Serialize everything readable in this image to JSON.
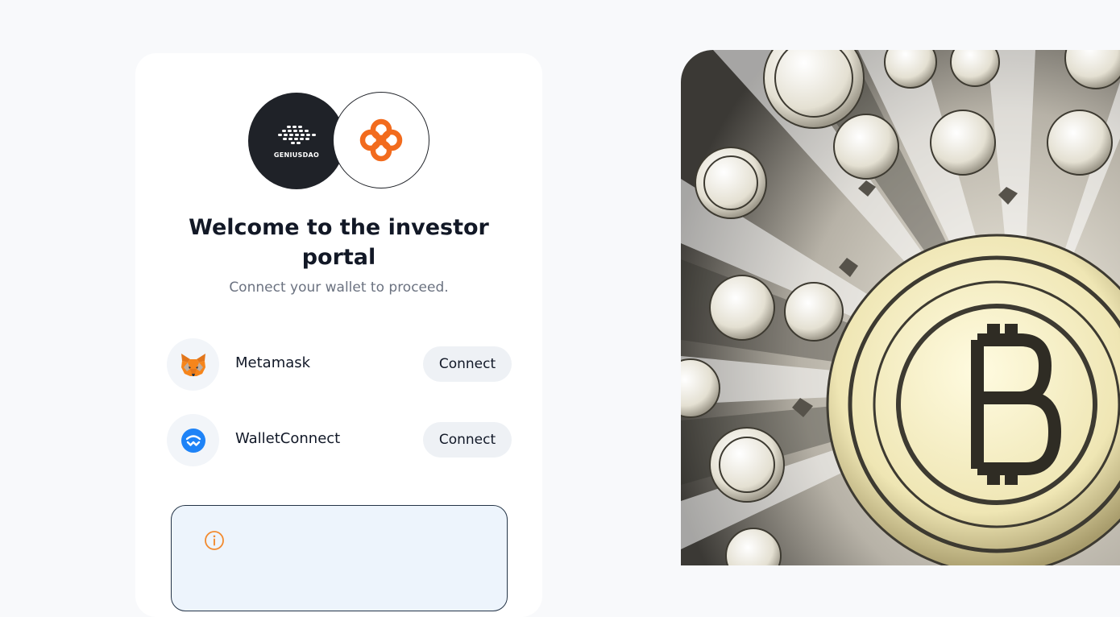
{
  "brand": {
    "dao_logo_text": "GENIUSDAO",
    "accent_color": "#f26b1d",
    "dark_color": "#1f2228"
  },
  "header": {
    "title": "Welcome to the investor portal",
    "subtitle": "Connect your wallet to proceed."
  },
  "wallets": [
    {
      "name": "Metamask",
      "icon": "metamask-fox-icon",
      "button_label": "Connect"
    },
    {
      "name": "WalletConnect",
      "icon": "walletconnect-icon",
      "button_label": "Connect"
    }
  ],
  "info_box": {
    "icon": "info-circle-icon",
    "icon_color": "#f28a2e"
  },
  "hero_image": {
    "subject": "bitcoin-coins-illustration"
  }
}
